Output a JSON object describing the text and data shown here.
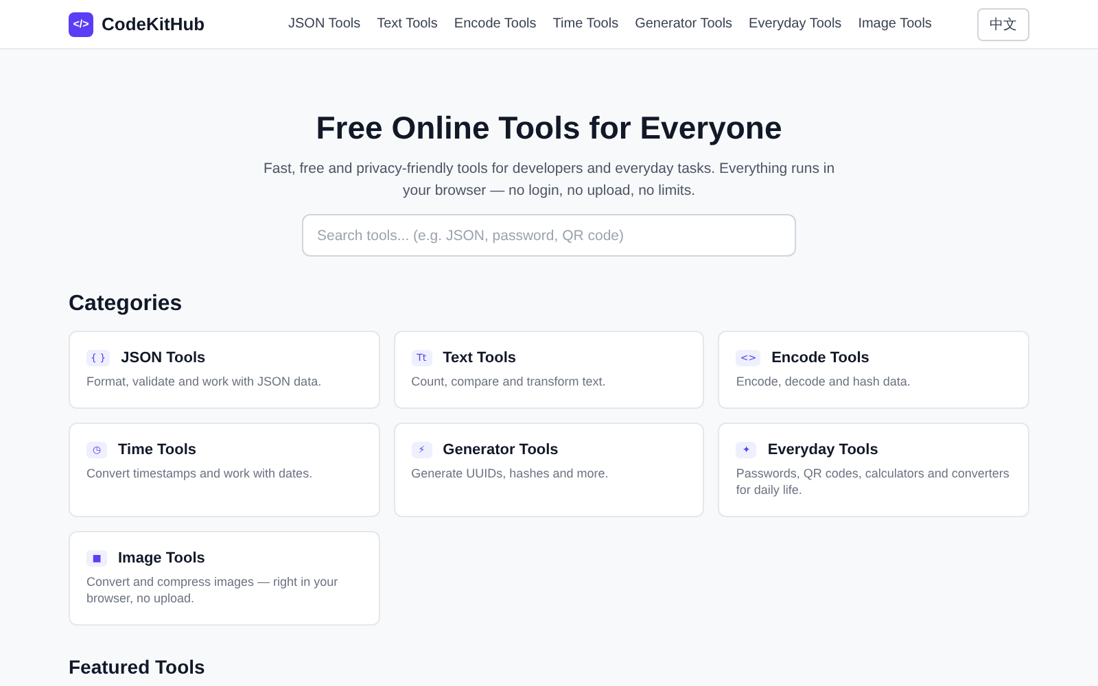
{
  "header": {
    "logo_mark": "</>",
    "brand": "CodeKitHub",
    "nav": [
      "JSON Tools",
      "Text Tools",
      "Encode Tools",
      "Time Tools",
      "Generator Tools",
      "Everyday Tools",
      "Image Tools"
    ],
    "language": "中文"
  },
  "hero": {
    "title": "Free Online Tools for Everyone",
    "subtitle": "Fast, free and privacy-friendly tools for developers and everyday tasks. Everything runs in your browser — no login, no upload, no limits.",
    "search": {
      "placeholder": "Search tools... (e.g. JSON, password, QR code)"
    }
  },
  "categories": {
    "heading": "Categories",
    "items": [
      {
        "icon": "{ }",
        "name": "JSON Tools",
        "description": "Format, validate and work with JSON data."
      },
      {
        "icon": "Tt",
        "name": "Text Tools",
        "description": "Count, compare and transform text."
      },
      {
        "icon": "<>",
        "name": "Encode Tools",
        "description": "Encode, decode and hash data."
      },
      {
        "icon": "◷",
        "name": "Time Tools",
        "description": "Convert timestamps and work with dates."
      },
      {
        "icon": "⚡",
        "name": "Generator Tools",
        "description": "Generate UUIDs, hashes and more."
      },
      {
        "icon": "✦",
        "name": "Everyday Tools",
        "description": "Passwords, QR codes, calculators and converters for daily life."
      },
      {
        "icon": "■",
        "name": "Image Tools",
        "description": "Convert and compress images — right in your browser, no upload."
      }
    ]
  },
  "featured": {
    "heading": "Featured Tools"
  }
}
